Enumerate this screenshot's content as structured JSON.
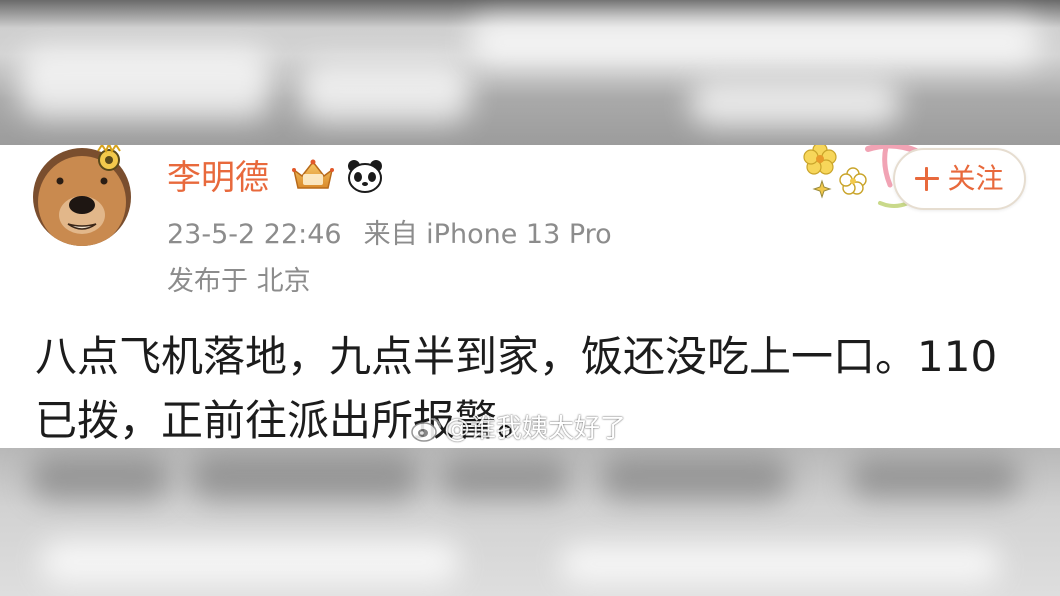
{
  "post": {
    "author": {
      "name": "李明德",
      "avatar_icon": "dog-avatar",
      "badges": [
        "crown-badge-icon",
        "panda-icon"
      ]
    },
    "timestamp": "23-5-2 22:46",
    "source": "来自 iPhone 13 Pro",
    "location": "发布于 北京",
    "content": "八点飞机落地，九点半到家，饭还没吃上一口。110已拨，正前往派出所报警。"
  },
  "follow_button": {
    "icon": "plus-icon",
    "label": "关注"
  },
  "watermark": {
    "icon": "weibo-logo-icon",
    "text": "@谁我姨太好了"
  },
  "colors": {
    "username": "#e8693c",
    "follow": "#e8693c",
    "meta": "#8c8c8c",
    "body": "#1c1c1c"
  }
}
